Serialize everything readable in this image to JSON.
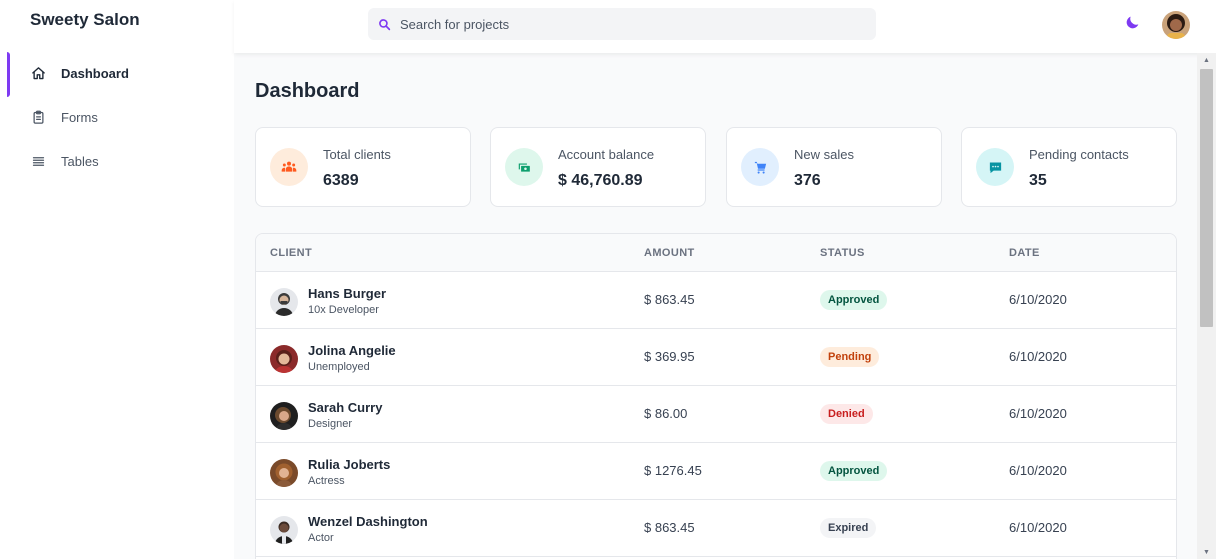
{
  "brand": "Sweety Salon",
  "nav": [
    {
      "label": "Dashboard",
      "icon": "home-icon"
    },
    {
      "label": "Forms",
      "icon": "clipboard-icon"
    },
    {
      "label": "Tables",
      "icon": "menu-lines-icon"
    }
  ],
  "search": {
    "placeholder": "Search for projects"
  },
  "page_title": "Dashboard",
  "cards": [
    {
      "label": "Total clients",
      "value": "6389",
      "icon": "people-icon",
      "color": "#ff5a1f",
      "bg": "#feecdc"
    },
    {
      "label": "Account balance",
      "value": "$ 46,760.89",
      "icon": "cash-icon",
      "color": "#0e9f6e",
      "bg": "#def7ec"
    },
    {
      "label": "New sales",
      "value": "376",
      "icon": "cart-icon",
      "color": "#3f83f8",
      "bg": "#e1effe"
    },
    {
      "label": "Pending contacts",
      "value": "35",
      "icon": "chat-icon",
      "color": "#0694a2",
      "bg": "#d5f5f6"
    }
  ],
  "table": {
    "headers": [
      "CLIENT",
      "AMOUNT",
      "STATUS",
      "DATE"
    ],
    "rows": [
      {
        "name": "Hans Burger",
        "role": "10x Developer",
        "amount": "$ 863.45",
        "status": "Approved",
        "date": "6/10/2020"
      },
      {
        "name": "Jolina Angelie",
        "role": "Unemployed",
        "amount": "$ 369.95",
        "status": "Pending",
        "date": "6/10/2020"
      },
      {
        "name": "Sarah Curry",
        "role": "Designer",
        "amount": "$ 86.00",
        "status": "Denied",
        "date": "6/10/2020"
      },
      {
        "name": "Rulia Joberts",
        "role": "Actress",
        "amount": "$ 1276.45",
        "status": "Approved",
        "date": "6/10/2020"
      },
      {
        "name": "Wenzel Dashington",
        "role": "Actor",
        "amount": "$ 863.45",
        "status": "Expired",
        "date": "6/10/2020"
      }
    ]
  },
  "colors": {
    "accent": "#7e3af2",
    "approved_bg": "#def7ec",
    "approved_fg": "#03543f",
    "pending_bg": "#feecdc",
    "pending_fg": "#c2410c",
    "denied_bg": "#fde8e8",
    "denied_fg": "#c81e1e",
    "expired_bg": "#f3f4f6",
    "expired_fg": "#374151"
  }
}
